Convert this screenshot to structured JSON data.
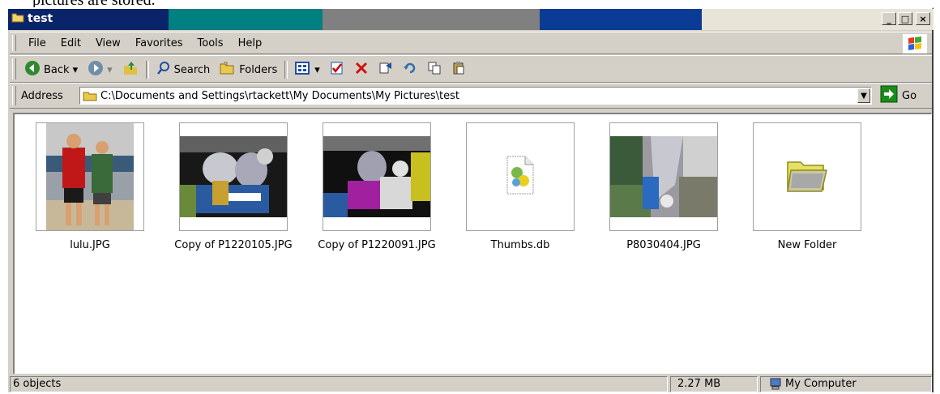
{
  "document": {
    "text_above": "pictures are stored."
  },
  "window": {
    "title": "test",
    "titlebar_colors": [
      "#0a246a",
      "#008080",
      "#808080",
      "#0a3c96",
      "#e8e4d8"
    ],
    "controls": {
      "minimize": "_",
      "maximize": "□",
      "close": "×"
    }
  },
  "menu": {
    "items": [
      {
        "label": "File"
      },
      {
        "label": "Edit"
      },
      {
        "label": "View"
      },
      {
        "label": "Favorites"
      },
      {
        "label": "Tools"
      },
      {
        "label": "Help"
      }
    ]
  },
  "toolbar": {
    "back_label": "Back",
    "search_label": "Search",
    "folders_label": "Folders",
    "icons": [
      "back-arrow-icon",
      "forward-arrow-icon",
      "up-folder-icon",
      "search-icon",
      "folders-icon",
      "views-icon",
      "move-to-icon",
      "delete-icon",
      "properties-icon",
      "undo-icon",
      "copy-icon",
      "paste-icon"
    ]
  },
  "address": {
    "label": "Address",
    "value": "C:\\Documents and Settings\\rtackett\\My Documents\\My Pictures\\test",
    "go_label": "Go"
  },
  "files": [
    {
      "name": "lulu.JPG",
      "kind": "photo"
    },
    {
      "name": "Copy of P1220105.JPG",
      "kind": "photo"
    },
    {
      "name": "Copy of P1220091.JPG",
      "kind": "photo"
    },
    {
      "name": "Thumbs.db",
      "kind": "file-icon"
    },
    {
      "name": "P8030404.JPG",
      "kind": "photo"
    },
    {
      "name": "New Folder",
      "kind": "folder-icon"
    }
  ],
  "status": {
    "objects": "6 objects",
    "size": "2.27 MB",
    "zone": "My Computer"
  },
  "colors": {
    "chrome": "#d4d0c8",
    "title_text": "#ffffff",
    "go_green": "#008000"
  }
}
